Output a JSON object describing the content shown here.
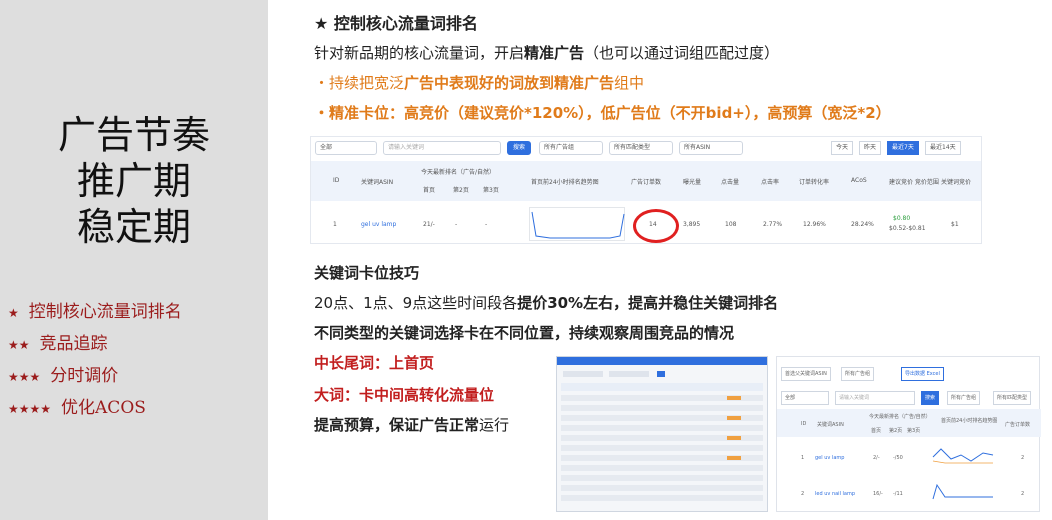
{
  "left": {
    "title_lines": [
      "广告节奏",
      "推广期",
      "稳定期"
    ],
    "steps": [
      {
        "stars": "★",
        "label": "控制核心流量词排名"
      },
      {
        "stars": "★★",
        "label": "竞品追踪"
      },
      {
        "stars": "★★★",
        "label": "分时调价"
      },
      {
        "stars": "★★★★",
        "label": "优化ACOS"
      }
    ]
  },
  "right": {
    "heading": "★ 控制核心流量词排名",
    "line2_a": "针对新品期的核心流量词，开启",
    "line2_b": "精准广告",
    "line2_c": "（也可以通过词组匹配过度）",
    "line3": "・持续把宽泛",
    "line3_b": "广告中表现好的词放到精准广告",
    "line3_c": "组中",
    "line4": "・精准卡位：高竞价（建议竞价*120%），低广告位（不开bid+），高预算（宽泛*2）",
    "table": {
      "filter_all": "全部",
      "search_placeholder": "请输入关键词",
      "search_btn": "搜索",
      "f1": "所有广告组",
      "f2": "所有匹配类型",
      "f3": "所有ASIN",
      "dates": [
        "今天",
        "昨天",
        "最近7天",
        "最近14天"
      ],
      "headers": [
        "ID",
        "关键词ASIN",
        "今天最新排名（广告/自然）",
        "首页",
        "第2页",
        "第3页",
        "首页前24小时排名趋势图",
        "广告订单数",
        "曝光量",
        "点击量",
        "点击率",
        "订单转化率",
        "ACoS",
        "建议竞价 竞价范围",
        "关键词竞价"
      ],
      "row": {
        "id": "1",
        "keyword": "gel uv lamp",
        "rank": "21/-",
        "p2": "-",
        "p3": "-",
        "orders": "14",
        "impr": "3,895",
        "clicks": "108",
        "ctr": "2.77%",
        "cvr": "12.96%",
        "acos": "28.24%",
        "bid": "$0.80",
        "range": "$0.52-$0.81",
        "kw_bid": "$1"
      }
    },
    "section": "关键词卡位技巧",
    "p1_a": "20点、1点、9点这些时间段各",
    "p1_b": "提价30%左右，提高并稳住关键词排名",
    "p2_a": "不同类型的",
    "p2_b": "关键词选择卡在不同位置，持续观察周围竞品的情况",
    "p3": "中长尾词：上首页",
    "p4": "大词：卡中间高转化流量位",
    "p5_a": "提高预算，保证广告正常",
    "p5_b": "运行",
    "screen2": {
      "tab1": "首选父关键词ASIN",
      "tab2": "所有广告组",
      "tab3": "导出数据 Excel",
      "filter_all": "全部",
      "placeholder": "请输入关键词",
      "btn": "搜索",
      "f1": "所有广告组",
      "f2": "所有匹配类型",
      "h_id": "ID",
      "h_kw": "关键词ASIN",
      "h_rank": "今天最新排名（广告/自然）",
      "h_p1": "首页",
      "h_p2": "第2页",
      "h_p3": "第3页",
      "h_trend": "首页前24小时排名趋势图",
      "h_orders": "广告订单数",
      "rows": [
        {
          "id": "1",
          "kw": "gel uv lamp",
          "r": "2/-",
          "p2": "-/50",
          "orders": "2"
        },
        {
          "id": "2",
          "kw": "led uv nail lamp",
          "r": "16/-",
          "p2": "-/11",
          "orders": "2"
        }
      ]
    }
  }
}
